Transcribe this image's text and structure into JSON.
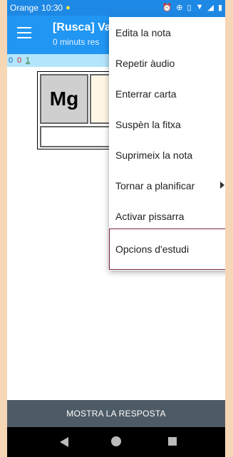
{
  "status": {
    "carrier": "Orange",
    "time": "10:30",
    "icons": [
      "notification-icon",
      "alarm-icon",
      "sync-icon",
      "vibrate-icon",
      "wifi-icon",
      "signal-icon",
      "battery-icon"
    ]
  },
  "toolbar": {
    "title": "[Rusca] Va",
    "subtitle": "0 minuts res",
    "menu_icon": "hamburger-icon"
  },
  "counts": {
    "new": "0",
    "learning": "0",
    "review": "1"
  },
  "card": {
    "symbol": "Mg"
  },
  "bottom": {
    "show_answer": "MOSTRA LA RESPOSTA"
  },
  "menu": {
    "items": [
      {
        "label": "Edita la nota"
      },
      {
        "label": "Repetir àudio"
      },
      {
        "label": "Enterrar carta"
      },
      {
        "label": "Suspèn la fitxa"
      },
      {
        "label": "Suprimeix la nota"
      },
      {
        "label": "Tornar a planificar"
      },
      {
        "label": "Activar pissarra"
      },
      {
        "label": "Opcions d'estudi"
      }
    ]
  },
  "colors": {
    "statusbar": "#1e88e5",
    "toolbar": "#2196f3",
    "counts_bar": "#b3e5fc",
    "new_count": "#1565c0",
    "learning_count": "#c62828",
    "review_count": "#2e7d32",
    "bottom_bar": "#4d5b66",
    "highlight_border": "#7b2240",
    "outer_background": "#f5d6b5"
  }
}
